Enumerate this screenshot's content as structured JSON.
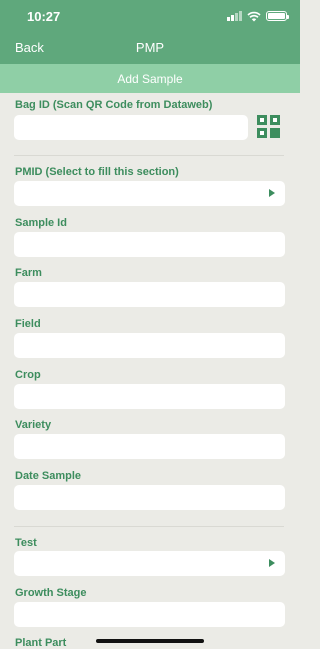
{
  "status_bar": {
    "time": "10:27"
  },
  "nav": {
    "back_label": "Back",
    "title": "PMP"
  },
  "subheader": {
    "title": "Add Sample"
  },
  "form": {
    "bag_id_label": "Bag ID (Scan QR Code from Dataweb)",
    "pmid_label": "PMID (Select to fill this section)",
    "sample_id_label": "Sample Id",
    "farm_label": "Farm",
    "field_label": "Field",
    "crop_label": "Crop",
    "variety_label": "Variety",
    "date_sample_label": "Date Sample",
    "test_label": "Test",
    "growth_stage_label": "Growth Stage",
    "plant_part_label": "Plant Part"
  },
  "icons": {
    "qr": "qr-code-scan-icon",
    "select_arrow": "triangle-right-icon",
    "signal": "cellular-signal-icon",
    "wifi": "wifi-icon",
    "battery": "battery-icon"
  },
  "colors": {
    "header": "#5fa87c",
    "subheader": "#8fcfa6",
    "label": "#3d8d5e",
    "background": "#ebebe6"
  }
}
